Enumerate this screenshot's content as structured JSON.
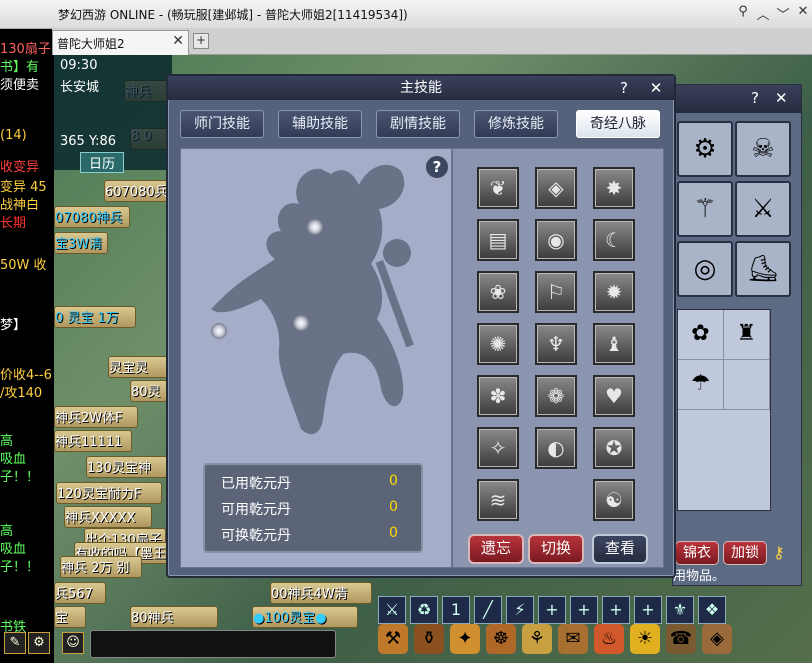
{
  "window": {
    "title": "梦幻西游 ONLINE - (畅玩服[建邺城] - 普陀大师姐2[11419534])",
    "controls": [
      "pin-icon",
      "minimize-icon",
      "restore-icon",
      "close-icon"
    ]
  },
  "browser_tabs": [
    {
      "label": "普陀大师姐2",
      "close": "✕"
    }
  ],
  "new_tab": "+",
  "chat_lines": [
    {
      "text": "130扇子",
      "color": "#ff6060"
    },
    {
      "text": "书】有",
      "color": "#60ff60"
    },
    {
      "text": "须便卖",
      "color": "#ffffff"
    },
    {
      "text": "(14)",
      "color": "#ffd040"
    },
    {
      "text": "收变异",
      "color": "#ff4040"
    },
    {
      "text": "变异 45",
      "color": "#ffd040"
    },
    {
      "text": "战神白",
      "color": "#ffd040"
    },
    {
      "text": "长期",
      "color": "#ff3030"
    },
    {
      "text": "50W 收",
      "color": "#ffd040"
    },
    {
      "text": "梦】",
      "color": "#ffffff"
    },
    {
      "text": "价收4--6",
      "color": "#ffd040"
    },
    {
      "text": "/攻140",
      "color": "#ffd040"
    },
    {
      "text": "高",
      "color": "#60ff60"
    },
    {
      "text": "吸血",
      "color": "#60ff60"
    },
    {
      "text": "子！！",
      "color": "#60ff60"
    },
    {
      "text": "高",
      "color": "#60ff60"
    },
    {
      "text": "吸血",
      "color": "#60ff60"
    },
    {
      "text": "子！！",
      "color": "#60ff60"
    },
    {
      "text": "书铁",
      "color": "#60ff60"
    }
  ],
  "hud": {
    "time": "09:30",
    "city": "长安城",
    "coords": "365 Y:86",
    "calendar": "日历"
  },
  "bg_strips": [
    {
      "text": "神兵",
      "cls": ""
    },
    {
      "text": "8 0",
      "cls": ""
    },
    {
      "text": "607080兵",
      "cls": ""
    },
    {
      "text": "07080神兵",
      "cls": "blue"
    },
    {
      "text": "宝3W清",
      "cls": "blue"
    },
    {
      "text": "0 灵宝 1万",
      "cls": "blue"
    },
    {
      "text": "灵宝灵",
      "cls": ""
    },
    {
      "text": "80灵",
      "cls": ""
    },
    {
      "text": "神兵2W体F",
      "cls": ""
    },
    {
      "text": "神兵11111",
      "cls": ""
    },
    {
      "text": "130灵宝神",
      "cls": ""
    },
    {
      "text": "120灵宝耐力F",
      "cls": ""
    },
    {
      "text": "神兵XXXXX",
      "cls": ""
    },
    {
      "text": "出个130扇子",
      "cls": ""
    },
    {
      "text": "有收的吗【墨王",
      "cls": ""
    },
    {
      "text": "神兵 2万 别",
      "cls": ""
    },
    {
      "text": "兵567",
      "cls": ""
    },
    {
      "text": "00神兵4W清",
      "cls": ""
    },
    {
      "text": "宝",
      "cls": ""
    },
    {
      "text": "80神兵",
      "cls": ""
    },
    {
      "text": "●100灵宝●",
      "cls": "blue"
    }
  ],
  "skills_dialog": {
    "title": "主技能",
    "help": "?",
    "close": "✕",
    "tabs": [
      "师门技能",
      "辅助技能",
      "剧情技能",
      "修炼技能",
      "奇经八脉"
    ],
    "active_tab": 4,
    "stats": [
      {
        "label": "已用乾元丹",
        "value": "0"
      },
      {
        "label": "可用乾元丹",
        "value": "0"
      },
      {
        "label": "可换乾元丹",
        "value": "0"
      }
    ],
    "skill_icons": [
      "❦",
      "◈",
      "✸",
      "▤",
      "◉",
      "☾",
      "❀",
      "⚐",
      "✹",
      "✺",
      "♆",
      "♝",
      "✽",
      "❁",
      "♥",
      "✧",
      "◐",
      "✪",
      "≋",
      "☯"
    ],
    "buttons": [
      "遗忘",
      "切换",
      "查看"
    ]
  },
  "inventory": {
    "help": "?",
    "close": "✕",
    "equipment": [
      "⚙",
      "☠",
      "⚚",
      "⚔",
      "◎",
      "⛸"
    ],
    "grid_items": [
      "✿",
      "♜",
      "☂",
      ""
    ],
    "buttons": [
      "锦衣",
      "加锁"
    ],
    "hint": "用物品。"
  },
  "quickslots": [
    "⚔",
    "♻",
    "1",
    "╱",
    "⚡",
    "+",
    "+",
    "+",
    "+",
    "⚜",
    "❖"
  ],
  "menu_icons": [
    "⚒",
    "⚱",
    "✦",
    "☸",
    "⚘",
    "✉",
    "♨",
    "☀",
    "☎",
    "◈"
  ],
  "chat_input": {
    "placeholder": ""
  }
}
